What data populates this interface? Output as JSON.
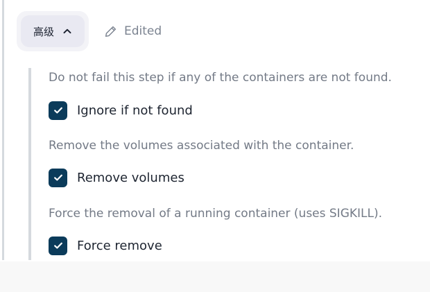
{
  "header": {
    "toggle_label": "高级",
    "toggle_icon": "chevron-up-icon",
    "edited_label": "Edited",
    "edited_icon": "pencil-icon"
  },
  "options": [
    {
      "description": "Do not fail this step if any of the containers are not found.",
      "label": "Ignore if not found",
      "checked": true
    },
    {
      "description": "Remove the volumes associated with the container.",
      "label": "Remove volumes",
      "checked": true
    },
    {
      "description": "Force the removal of a running container (uses SIGKILL).",
      "label": "Force remove",
      "checked": true
    }
  ],
  "colors": {
    "checkbox": "#0b3b5a",
    "text": "#1d2430",
    "muted": "#737a86"
  }
}
